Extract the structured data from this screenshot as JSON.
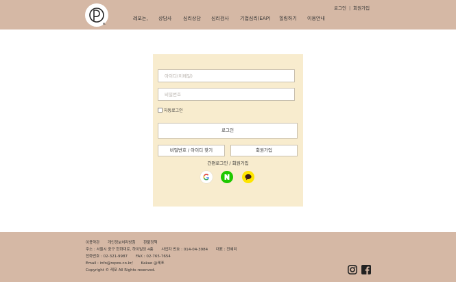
{
  "header": {
    "logo_text": "e.",
    "nav": [
      "레포는,",
      "상담사",
      "심리상담",
      "심리검사",
      "기업심리(EAP)",
      "힐링하기",
      "이용안내"
    ],
    "login_link": "로그인",
    "divider": "|",
    "signup_link": "회원가입"
  },
  "login": {
    "id_placeholder": "아이디(이메일)",
    "pw_placeholder": "비밀번호",
    "auto_login": "자동로그인",
    "login_button": "로그인",
    "find_button": "비밀번호 / 아이디 찾기",
    "signup_button": "회원가입",
    "easy_login": "간편로그인 / 회원가입",
    "social": [
      "google-icon",
      "naver-icon",
      "kakao-icon"
    ]
  },
  "footer": {
    "links": [
      "이용약관",
      "개인정보처리방침",
      "환불정책"
    ],
    "address": "주소 : 서울시 중구 한화대로, 하이빌딩 4층",
    "biz_no": "사업자 번호 : 014-04-3984",
    "ceo": "대표 : 전혜리",
    "phone": "전화번호 : 02-321-9987",
    "fax": "FAX : 02-765-7654",
    "email": "Email : info@repos.co.kr/",
    "kakao": "Kakao @레포",
    "copyright": "Copyright © 레포 All Rights reserved."
  },
  "colors": {
    "header_bg": "#d5b8a5",
    "panel_bg": "#f8ecce",
    "naver": "#1ec800",
    "kakao": "#fee500"
  }
}
